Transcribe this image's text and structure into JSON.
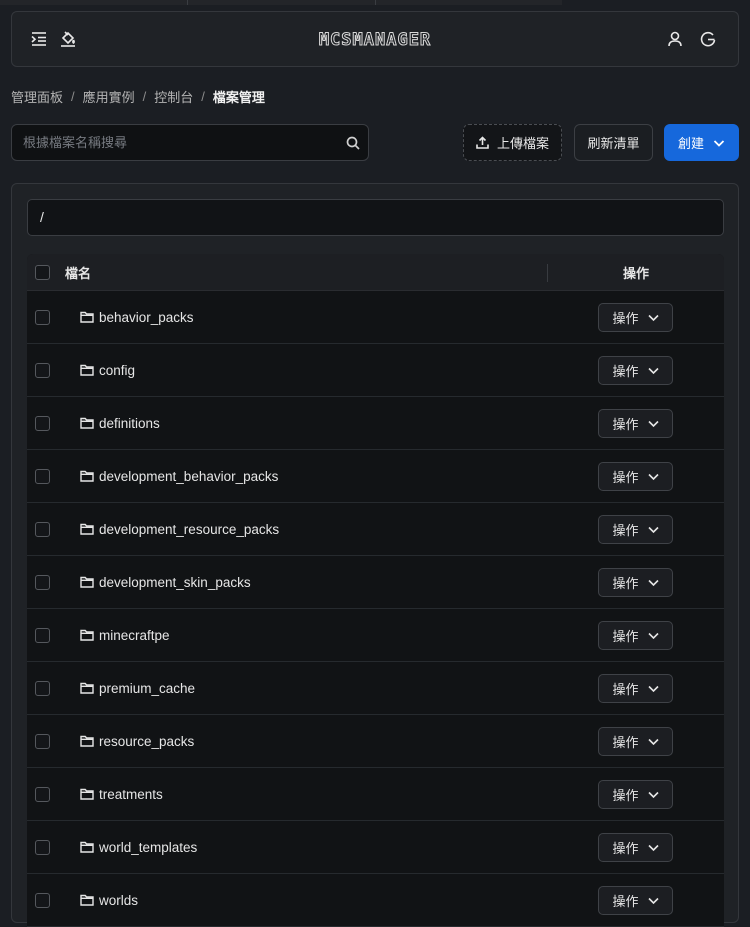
{
  "header": {
    "logo_text": "MCSMANAGER"
  },
  "breadcrumb": {
    "items": [
      "管理面板",
      "應用實例",
      "控制台"
    ],
    "current": "檔案管理",
    "separator": "/"
  },
  "search": {
    "placeholder": "根據檔案名稱搜尋",
    "value": ""
  },
  "toolbar": {
    "upload_label": "上傳檔案",
    "refresh_label": "刷新清單",
    "create_label": "創建"
  },
  "path": {
    "current": "/"
  },
  "table": {
    "col_name": "檔名",
    "col_action": "操作",
    "action_label": "操作",
    "rows": [
      {
        "name": "behavior_packs"
      },
      {
        "name": "config"
      },
      {
        "name": "definitions"
      },
      {
        "name": "development_behavior_packs"
      },
      {
        "name": "development_resource_packs"
      },
      {
        "name": "development_skin_packs"
      },
      {
        "name": "minecraftpe"
      },
      {
        "name": "premium_cache"
      },
      {
        "name": "resource_packs"
      },
      {
        "name": "treatments"
      },
      {
        "name": "world_templates"
      },
      {
        "name": "worlds"
      }
    ]
  },
  "colors": {
    "accent": "#1668dc",
    "background": "#1b1e23",
    "panel": "#1f2226"
  }
}
